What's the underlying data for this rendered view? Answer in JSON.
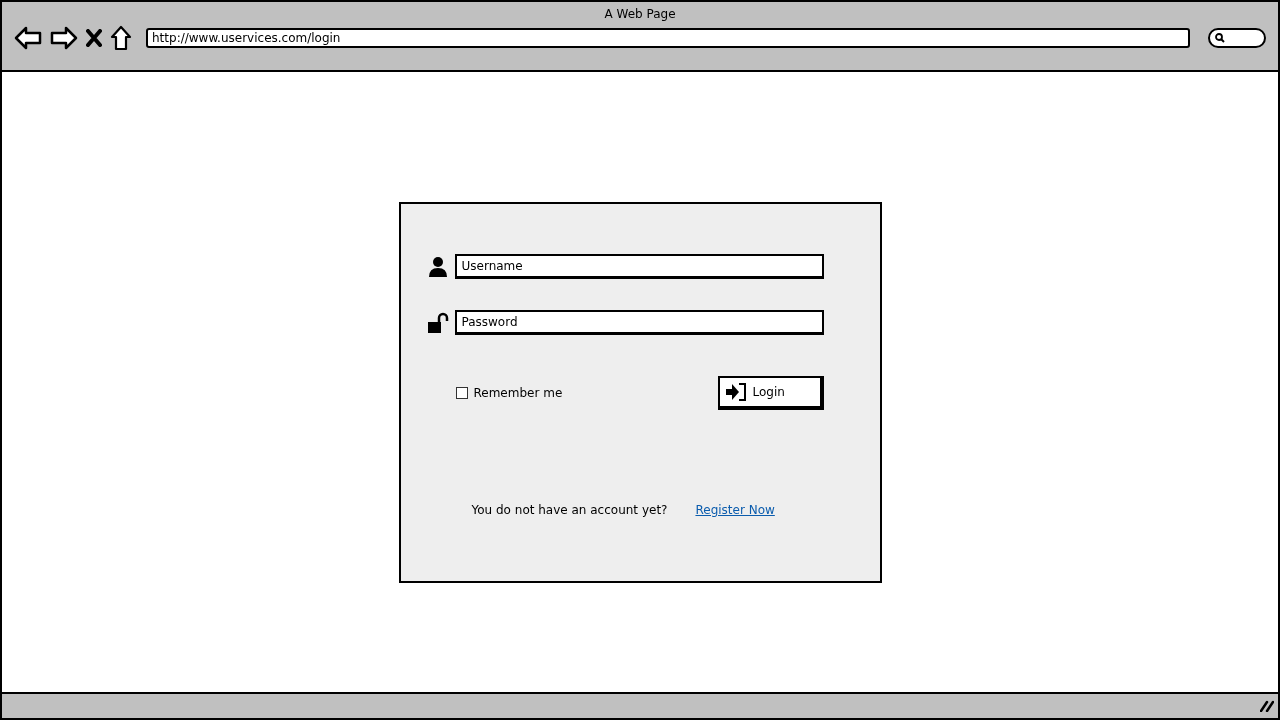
{
  "window": {
    "title": "A Web Page"
  },
  "address_bar": {
    "value": "http://www.uservices.com/login"
  },
  "login_form": {
    "username": {
      "placeholder": "Username"
    },
    "password": {
      "placeholder": "Password"
    },
    "remember_me": {
      "label": "Remember me",
      "checked": false
    },
    "login_button": "Login",
    "register_prompt": "You do not have an account yet?",
    "register_link": "Register Now"
  }
}
